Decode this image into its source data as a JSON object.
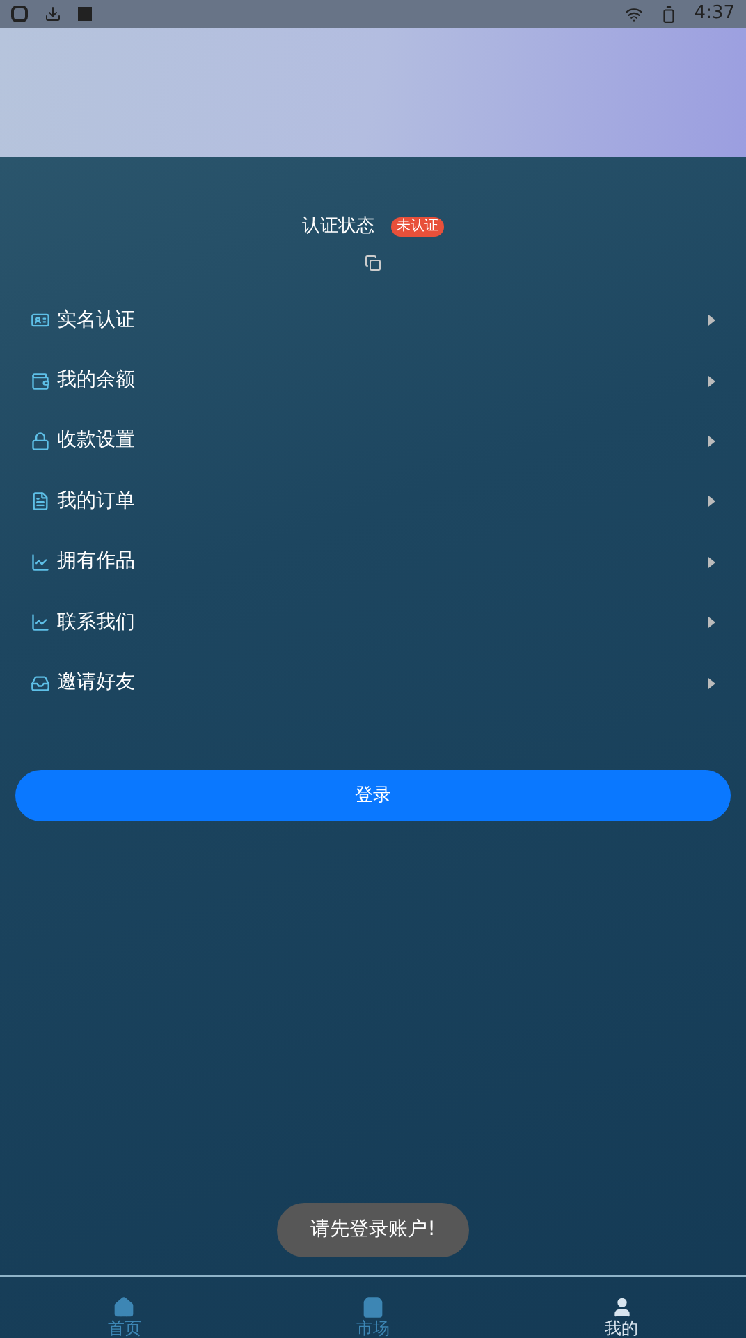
{
  "status_bar": {
    "time": "4:37"
  },
  "auth": {
    "label": "认证状态",
    "badge": "未认证"
  },
  "menu": [
    {
      "label": "实名认证"
    },
    {
      "label": "我的余额"
    },
    {
      "label": "收款设置"
    },
    {
      "label": "我的订单"
    },
    {
      "label": "拥有作品"
    },
    {
      "label": "联系我们"
    },
    {
      "label": "邀请好友"
    }
  ],
  "login_button": "登录",
  "toast": "请先登录账户!",
  "bottom_nav": [
    {
      "label": "首页",
      "selected": false
    },
    {
      "label": "市场",
      "selected": false
    },
    {
      "label": "我的",
      "selected": true
    }
  ]
}
